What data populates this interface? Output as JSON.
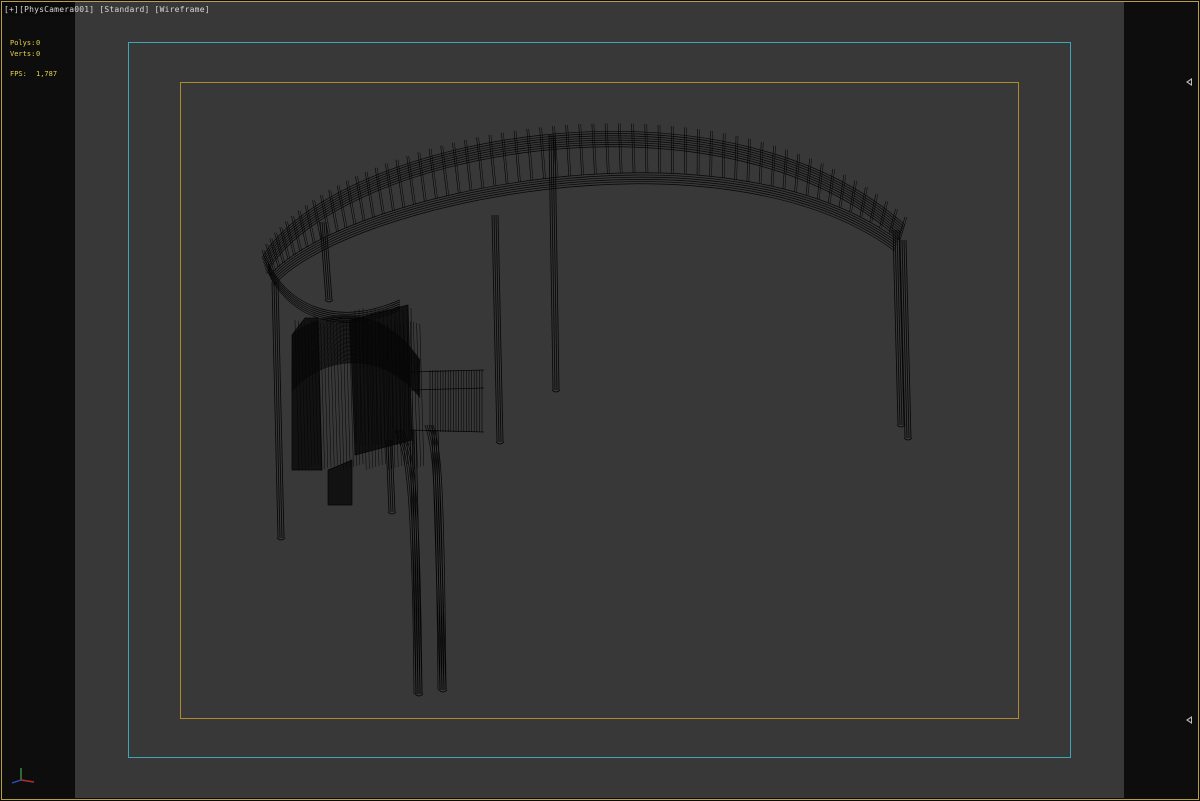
{
  "viewport": {
    "menus": [
      "[+]",
      "[PhysCamera001]",
      "[Standard]",
      "[Wireframe]"
    ],
    "stats": {
      "polys_label": "Polys:",
      "polys_value": "0",
      "verts_label": "Verts:",
      "verts_value": "0",
      "fps_label": "FPS:",
      "fps_value": "1,787"
    },
    "shading_mode": "Wireframe",
    "camera": "PhysCamera001"
  },
  "colors": {
    "viewport_border": "#b8a03a",
    "safe_frame": "#3fa6b4",
    "action_frame": "#b08a2c",
    "stats_text": "#e8d24a",
    "scene_bg": "#383838",
    "wireframe": "#050505"
  },
  "icons": {
    "right_marker_top": "triangle-left-icon",
    "right_marker_bottom": "triangle-left-icon",
    "axis": "axis-tripod-icon"
  }
}
